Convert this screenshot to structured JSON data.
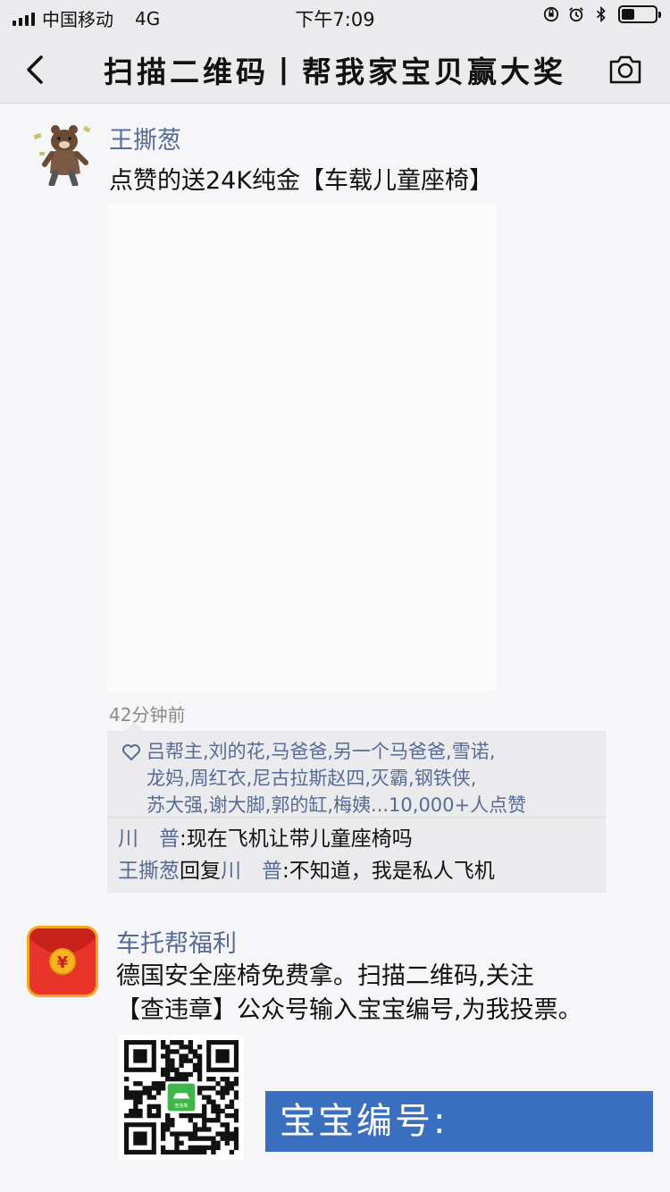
{
  "status_bar": {
    "carrier": "中国移动",
    "network": "4G",
    "time": "下午7:09",
    "battery_level": 0.4
  },
  "nav": {
    "title": "扫描二维码丨帮我家宝贝赢大奖",
    "back_icon": "chevron-left-icon",
    "camera_icon": "camera-icon"
  },
  "post": {
    "author": "王撕葱",
    "text": "点赞的送24K纯金【车载儿童座椅】",
    "time": "42分钟前",
    "likes_lines": [
      "吕帮主,刘的花,马爸爸,另一个马爸爸,雪诺,",
      "龙妈,周红衣,尼古拉斯赵四,灭霸,钢铁侠,",
      "苏大强,谢大脚,郭的缸,梅姨...10,000+人点赞"
    ],
    "comments": [
      {
        "name": "川　普",
        "separator": ":",
        "text": "现在飞机让带儿童座椅吗"
      },
      {
        "name": "王撕葱",
        "reply_word": "回复",
        "reply_to": "川　普",
        "separator": ":",
        "text": "不知道，我是私人飞机"
      }
    ]
  },
  "post2": {
    "author": "车托帮福利",
    "lines": [
      "德国安全座椅免费拿。扫描二维码,关注",
      "【查违章】公众号输入宝宝编号,为我投票。"
    ],
    "banner": "宝宝编号:",
    "qr_center_label": "查违章"
  },
  "colors": {
    "link": "#576b95",
    "banner": "#3a6fc0",
    "red_packet": "#e8342a",
    "coin": "#f5b51c"
  }
}
